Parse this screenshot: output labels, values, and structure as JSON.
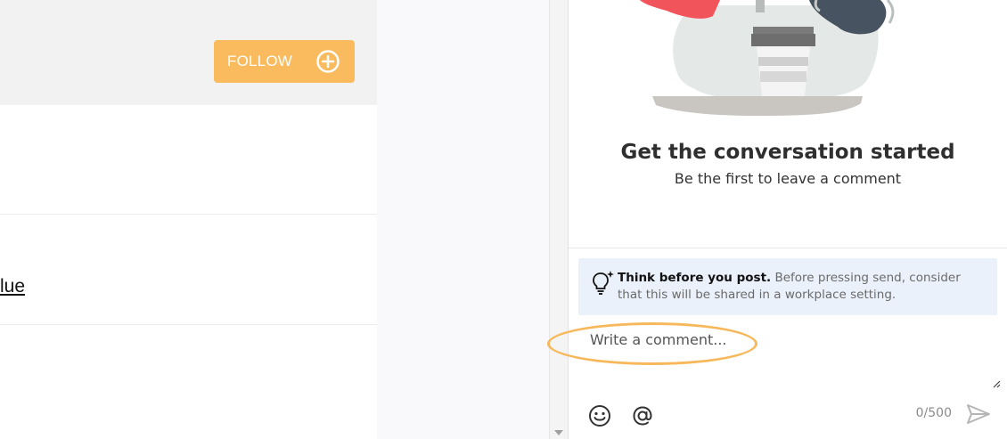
{
  "left": {
    "follow_label": "FOLLOW",
    "link_fragment": "lue"
  },
  "comments": {
    "empty_title": "Get the conversation started",
    "empty_subtitle": "Be the first to leave a comment",
    "tip_heading": "Think before you post.",
    "tip_body": " Before pressing send, consider that this will be shared in a workplace setting.",
    "input_placeholder": "Write a comment...",
    "char_count": "0/500"
  },
  "icons": {
    "follow": "plus-circle-icon",
    "tip": "lightbulb-icon",
    "emoji": "smiley-icon",
    "mention": "at-sign-icon",
    "send": "send-icon",
    "illustration": "coffee-conversation-illustration"
  },
  "colors": {
    "accent": "#f9bb5d",
    "tip_background": "#eaf1fa",
    "illustration_red": "#f2545b",
    "illustration_dark": "#475360"
  }
}
